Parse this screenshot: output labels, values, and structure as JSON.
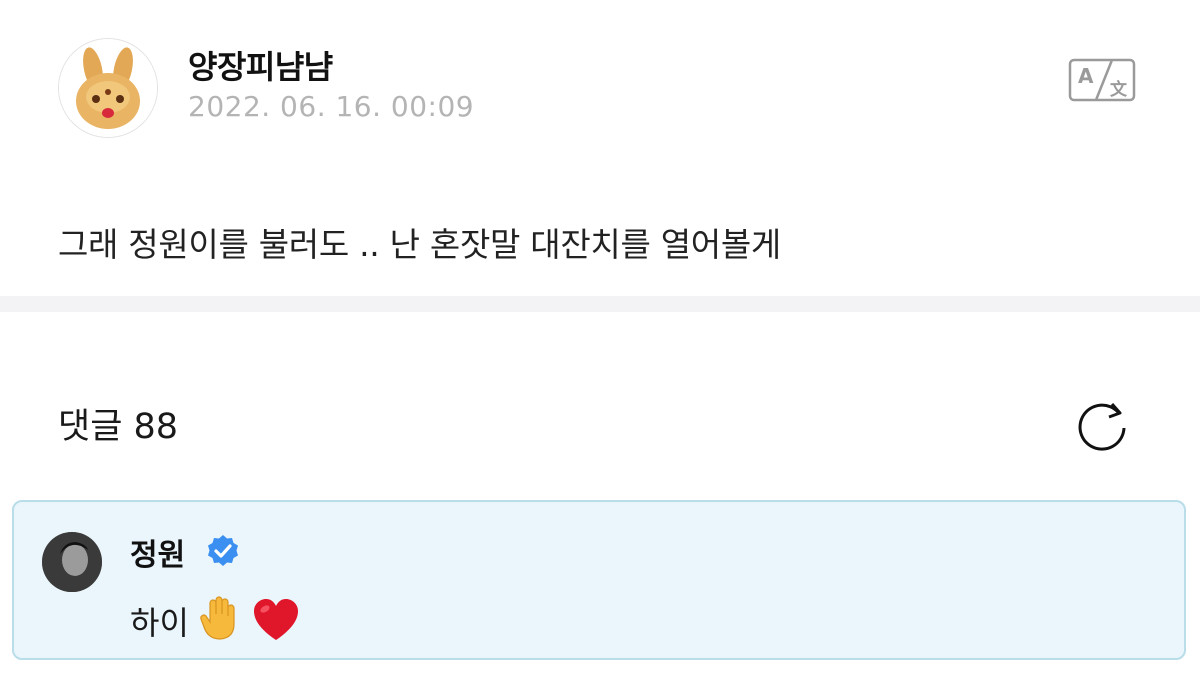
{
  "post": {
    "author": "양장피냠냠",
    "date": "2022. 06. 16. 00:09",
    "body": "그래 정원이를 불러도 .. 난 혼잣말 대잔치를 열어볼게",
    "avatar_icon": "bread-bunny-avatar",
    "translate_icon": "translate-icon"
  },
  "comments": {
    "label": "댓글 88",
    "refresh_icon": "refresh-icon",
    "items": [
      {
        "author": "정원",
        "verified": true,
        "text": "하이",
        "emojis": [
          "raised-hand-emoji",
          "red-heart-emoji"
        ]
      }
    ]
  },
  "colors": {
    "date_gray": "#b4b4b4",
    "divider": "#f3f3f6",
    "comment_bg": "#eaf6fc",
    "comment_border": "#b9dde9",
    "verified_blue": "#3a8ff0",
    "heart_red": "#e0162b"
  }
}
